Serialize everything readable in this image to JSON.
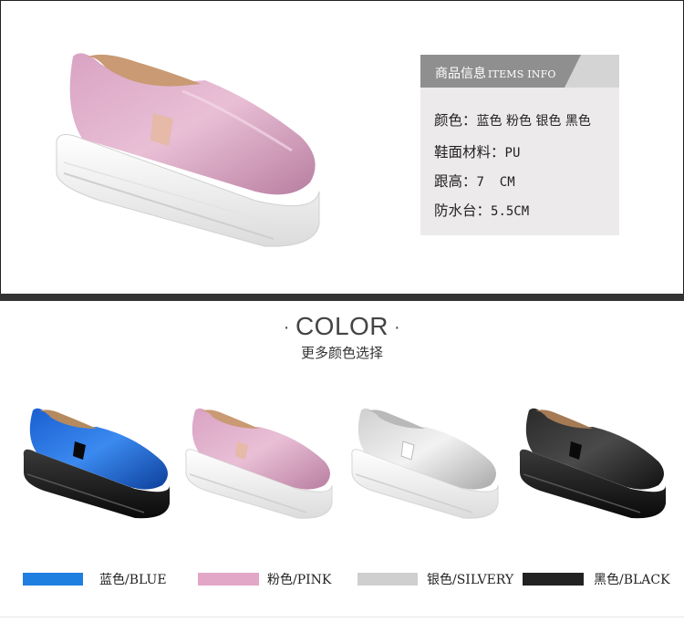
{
  "items_info": {
    "header_cn": "商品信息",
    "header_en": "ITEMS INFO",
    "color_label": "颜色：",
    "color_value": "蓝色 粉色 银色 黑色",
    "material_label": "鞋面材料：",
    "material_value": "PU",
    "heel_label": "跟高：",
    "heel_value": "7  CM",
    "platform_label": "防水台：",
    "platform_value": "5.5CM"
  },
  "colors_section": {
    "title": "COLOR",
    "subtitle": "更多颜色选择",
    "variants": [
      {
        "label": "蓝色/BLUE",
        "color": "#1f7fe0"
      },
      {
        "label": "粉色/PINK",
        "color": "#e2a6c6"
      },
      {
        "label": "银色/SILVERY",
        "color": "#cfcfcf"
      },
      {
        "label": "黑色/BLACK",
        "color": "#222222"
      }
    ]
  },
  "icons": {
    "hero": "pink-platform-shoe-image",
    "blue": "blue-shoe-image",
    "pink": "pink-shoe-image",
    "silver": "silver-shoe-image",
    "black": "black-shoe-image"
  }
}
